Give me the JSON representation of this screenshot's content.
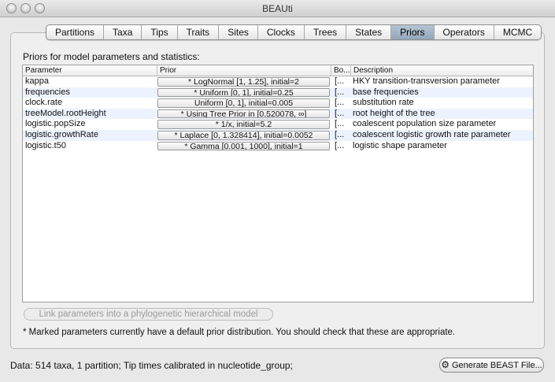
{
  "window": {
    "title": "BEAUti"
  },
  "tabs": [
    {
      "label": "Partitions"
    },
    {
      "label": "Taxa"
    },
    {
      "label": "Tips"
    },
    {
      "label": "Traits"
    },
    {
      "label": "Sites"
    },
    {
      "label": "Clocks"
    },
    {
      "label": "Trees"
    },
    {
      "label": "States"
    },
    {
      "label": "Priors",
      "active": true
    },
    {
      "label": "Operators"
    },
    {
      "label": "MCMC"
    }
  ],
  "priors": {
    "heading": "Priors for model parameters and statistics:",
    "columns": {
      "parameter": "Parameter",
      "prior": "Prior",
      "bound": "Bo...",
      "description": "Description"
    },
    "rows": [
      {
        "parameter": "kappa",
        "prior": "* LogNormal [1, 1.25], initial=2",
        "bound": "[...",
        "description": "HKY transition-transversion parameter"
      },
      {
        "parameter": "frequencies",
        "prior": "* Uniform [0, 1], initial=0.25",
        "bound": "[...",
        "description": "base frequencies"
      },
      {
        "parameter": "clock.rate",
        "prior": "Uniform [0, 1], initial=0.005",
        "bound": "[...",
        "description": "substitution rate"
      },
      {
        "parameter": "treeModel.rootHeight",
        "prior": "* Using Tree Prior in [0.520078, ∞]",
        "bound": "[...",
        "description": "root height of the tree"
      },
      {
        "parameter": "logistic.popSize",
        "prior": "* 1/x, initial=5.2",
        "bound": "[...",
        "description": "coalescent population size parameter"
      },
      {
        "parameter": "logistic.growthRate",
        "prior": "* Laplace [0, 1.328414], initial=0.0052",
        "bound": "[...",
        "description": "coalescent logistic growth rate parameter"
      },
      {
        "parameter": "logistic.t50",
        "prior": "* Gamma [0.001, 1000], initial=1",
        "bound": "[...",
        "description": "logistic shape parameter"
      }
    ],
    "link_button": "Link parameters into a phylogenetic hierarchical model",
    "footnote": "* Marked parameters currently have a default prior distribution. You should check that these are appropriate."
  },
  "status": {
    "text": "Data: 514 taxa, 1 partition; Tip times calibrated in nucleotide_group;",
    "generate_button": "Generate BEAST File...",
    "generate_icon": "gear-icon"
  },
  "colors": {
    "active_tab": "#9fb1c4",
    "row_alt": "#edf3fe"
  }
}
